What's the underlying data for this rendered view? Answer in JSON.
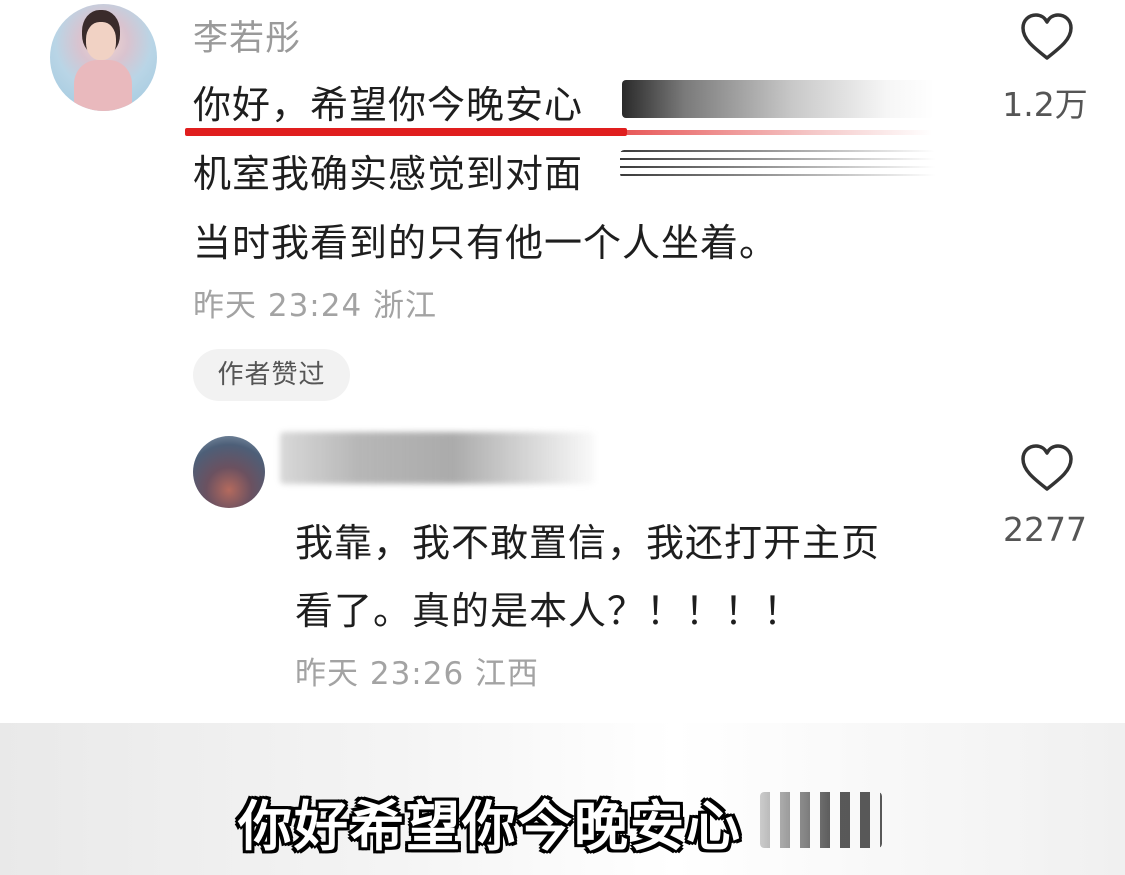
{
  "main_comment": {
    "username": "李若彤",
    "lines": [
      "你好，希望你今晚安心",
      "机室我确实感觉到对面",
      "当时我看到的只有他一个人坐着。"
    ],
    "meta": "昨天 23:24 浙江",
    "like_count": "1.2万",
    "badge": "作者赞过"
  },
  "reply": {
    "lines": [
      "我靠，我不敢置信，我还打开主页",
      "看了。真的是本人？！！！！"
    ],
    "meta": "昨天 23:26 江西",
    "like_count": "2277"
  },
  "subtitle": "你好希望你今晚安心",
  "icons": {
    "like": "heart-outline-icon",
    "avatar_main": "avatar",
    "avatar_reply": "avatar"
  },
  "colors": {
    "accent_underline": "#e01e1e",
    "meta_text": "#a3a3a3",
    "body_text": "#1e1e1e"
  }
}
